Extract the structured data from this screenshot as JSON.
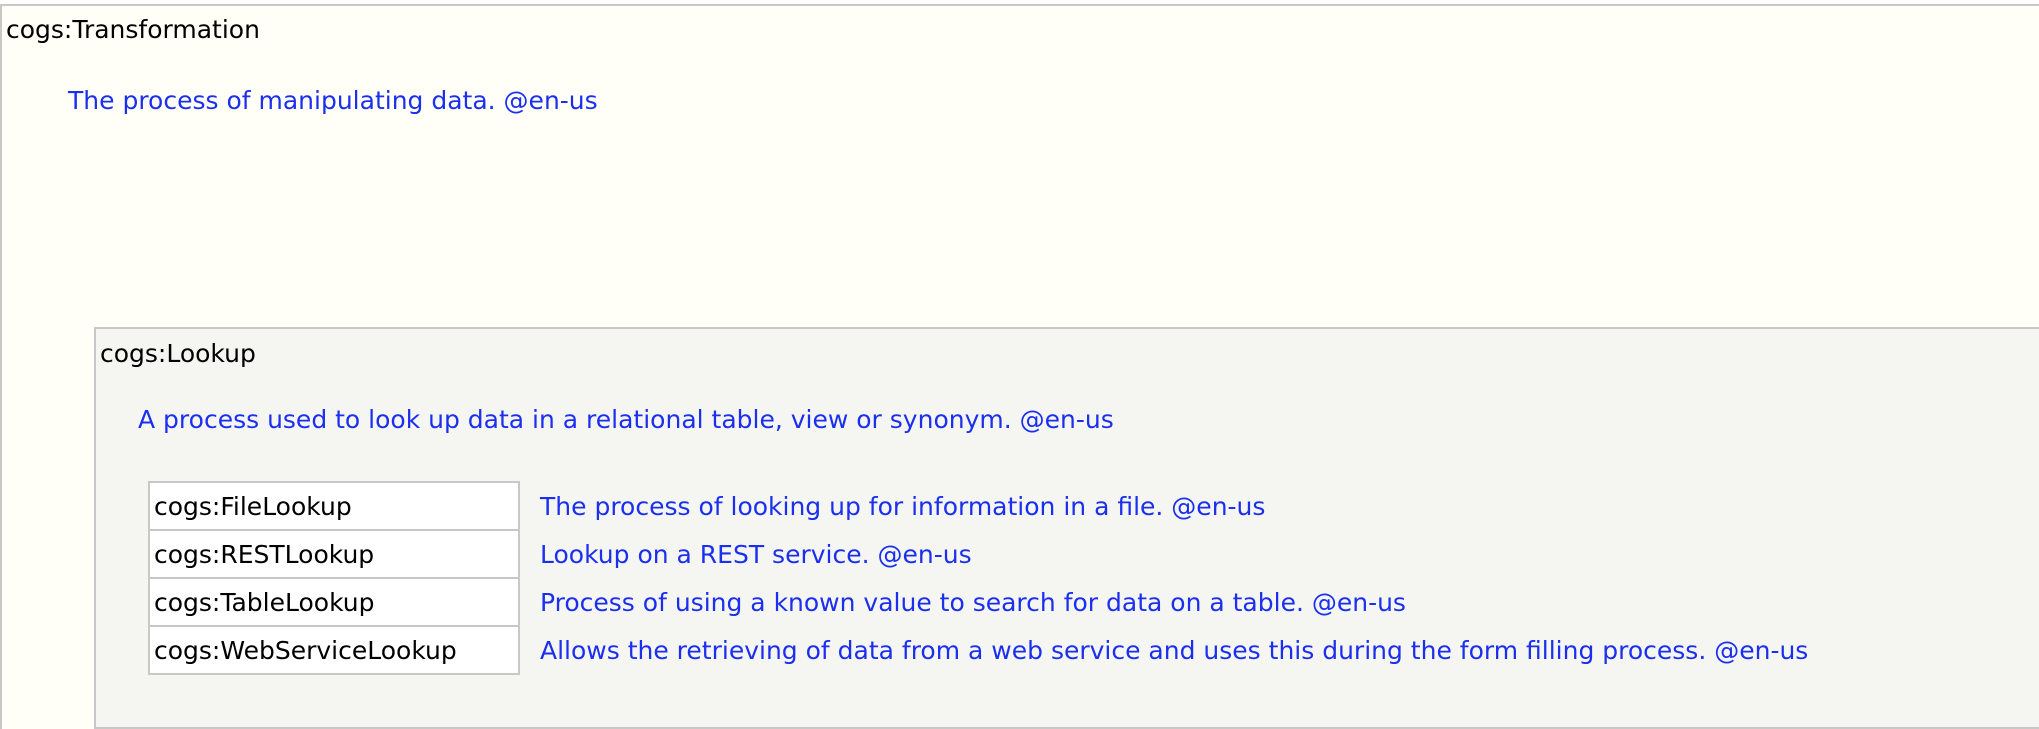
{
  "transformation": {
    "title": "cogs:Transformation",
    "description": "The process of manipulating data. @en-us"
  },
  "lookup": {
    "title": "cogs:Lookup",
    "description": "A process used to look up data in a relational table, view or synonym. @en-us",
    "subclasses": [
      {
        "name": "cogs:FileLookup",
        "description": "The process of looking up for information in a file. @en-us"
      },
      {
        "name": "cogs:RESTLookup",
        "description": "Lookup on a REST service. @en-us"
      },
      {
        "name": "cogs:TableLookup",
        "description": "Process of using a known value to search for data on a table. @en-us"
      },
      {
        "name": "cogs:WebServiceLookup",
        "description": "Allows the retrieving of data from a web service and uses this during the form filling process.  @en-us"
      }
    ]
  }
}
